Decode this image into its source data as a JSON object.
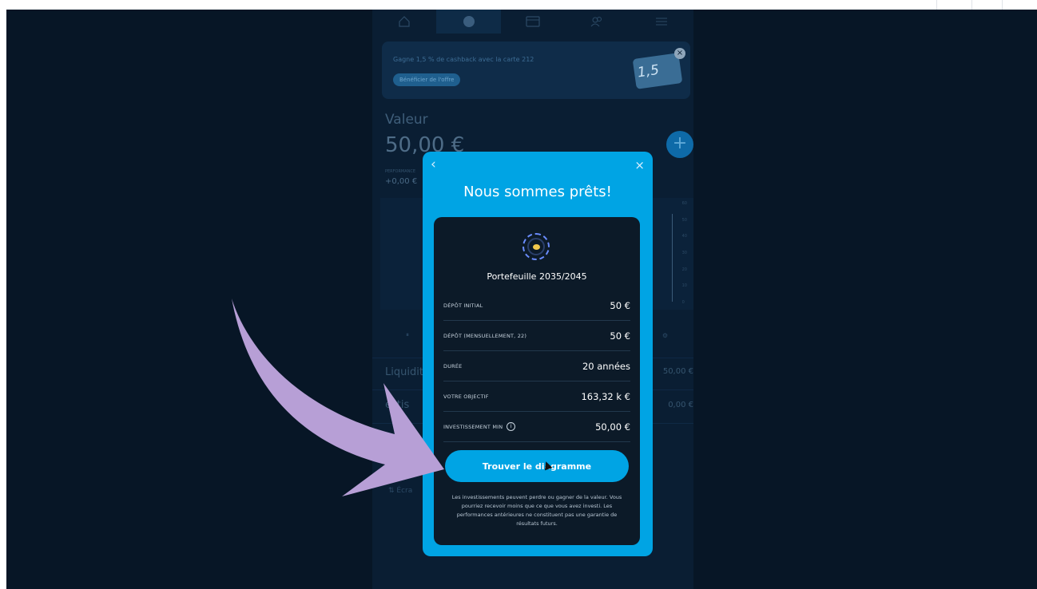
{
  "nav": {
    "items": [
      {
        "icon": "home-icon"
      },
      {
        "icon": "portfolio-icon"
      },
      {
        "icon": "card-icon"
      },
      {
        "icon": "users-icon"
      },
      {
        "icon": "menu-icon"
      }
    ]
  },
  "promo": {
    "text": "Gagne 1,5 % de cashback avec la carte 212",
    "button": "Bénéficier de l'offre",
    "card_text": "1,5",
    "close": "×"
  },
  "portfolio": {
    "value_label": "Valeur",
    "value_amount": "50,00 €",
    "change_label": "PERFORMANCE",
    "change": "+0,00 €",
    "add_button": "+"
  },
  "chart_ticks": [
    "60",
    "50",
    "40",
    "30",
    "20",
    "10",
    "0"
  ],
  "balances": {
    "liquidity_label": "Liquidit",
    "liquidity_value": "50,00 €",
    "invest_label": "estis",
    "invest_value": "0,00 €"
  },
  "bottom_link": "Écra",
  "modal": {
    "back": "‹",
    "close": "×",
    "title": "Nous sommes prêts!",
    "portfolio_name": "Portefeuille 2035/2045",
    "rows": [
      {
        "key": "DÉPÔT INITIAL",
        "value": "50 €"
      },
      {
        "key": "DÉPÔT (MENSUELLEMENT, 22)",
        "value": "50 €"
      },
      {
        "key": "DURÉE",
        "value": "20 années"
      },
      {
        "key": "VOTRE OBJECTIF",
        "value": "163,32 k €"
      },
      {
        "key": "INVESTISSEMENT MIN",
        "value": "50,00 €"
      }
    ],
    "cta": "Trouver le diagramme",
    "disclaimer": "Les investissements peuvent perdre ou gagner de la valeur. Vous pourriez recevoir moins que ce que vous avez investi. Les performances antérieures ne constituent pas une garantie de résultats futurs."
  },
  "colors": {
    "backdrop": "#071626",
    "modal": "#00a4e4",
    "card": "#0c1a28",
    "arrow": "#b79fd6"
  }
}
